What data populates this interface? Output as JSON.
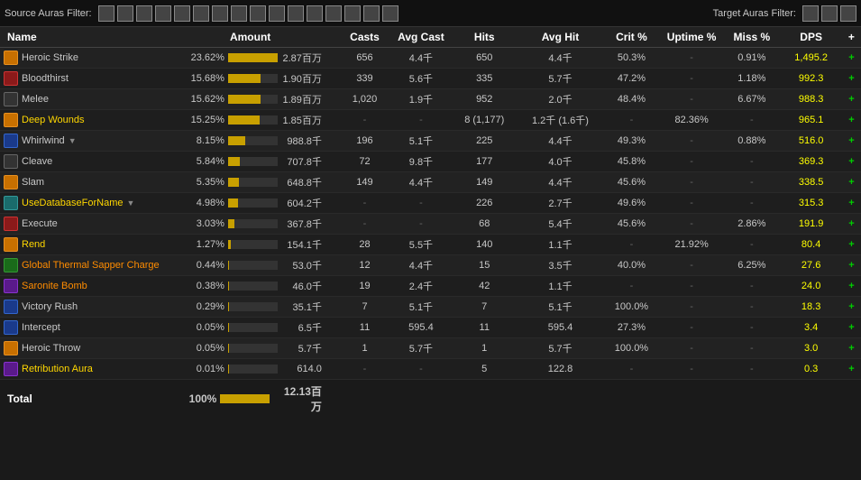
{
  "topBar": {
    "sourceLabel": "Source Auras Filter:",
    "targetLabel": "Target Auras Filter:"
  },
  "table": {
    "headers": [
      "Name",
      "Amount",
      "",
      "Casts",
      "Avg Cast",
      "Hits",
      "Avg Hit",
      "Crit %",
      "Uptime %",
      "Miss %",
      "DPS",
      "+"
    ],
    "rows": [
      {
        "icon": "orange",
        "name": "Heroic Strike",
        "nameStyle": "",
        "pct": "23.62%",
        "barW": 100,
        "amount": "2.87百万",
        "casts": "656",
        "avgCast": "4.4千",
        "hits": "650",
        "avgHit": "4.4千",
        "crit": "50.3%",
        "uptime": "-",
        "miss": "0.91%",
        "dps": "1,495.2"
      },
      {
        "icon": "red",
        "name": "Bloodthirst",
        "nameStyle": "",
        "pct": "15.68%",
        "barW": 66,
        "amount": "1.90百万",
        "casts": "339",
        "avgCast": "5.6千",
        "hits": "335",
        "avgHit": "5.7千",
        "crit": "47.2%",
        "uptime": "-",
        "miss": "1.18%",
        "dps": "992.3"
      },
      {
        "icon": "dark",
        "name": "Melee",
        "nameStyle": "",
        "pct": "15.62%",
        "barW": 66,
        "amount": "1.89百万",
        "casts": "1,020",
        "avgCast": "1.9千",
        "hits": "952",
        "avgHit": "2.0千",
        "crit": "48.4%",
        "uptime": "-",
        "miss": "6.67%",
        "dps": "988.3"
      },
      {
        "icon": "orange",
        "name": "Deep Wounds",
        "nameStyle": "yellow",
        "pct": "15.25%",
        "barW": 64,
        "amount": "1.85百万",
        "casts": "-",
        "avgCast": "-",
        "hits": "8 (1,177)",
        "avgHit": "1.2千 (1.6千)",
        "crit": "-",
        "uptime": "82.36%",
        "miss": "-",
        "dps": "965.1"
      },
      {
        "icon": "blue",
        "name": "Whirlwind",
        "nameStyle": "",
        "pct": "8.15%",
        "barW": 34,
        "amount": "988.8千",
        "casts": "196",
        "avgCast": "5.1千",
        "hits": "225",
        "avgHit": "4.4千",
        "crit": "49.3%",
        "uptime": "-",
        "miss": "0.88%",
        "dps": "516.0",
        "hasArrow": true
      },
      {
        "icon": "dark",
        "name": "Cleave",
        "nameStyle": "",
        "pct": "5.84%",
        "barW": 24,
        "amount": "707.8千",
        "casts": "72",
        "avgCast": "9.8千",
        "hits": "177",
        "avgHit": "4.0千",
        "crit": "45.8%",
        "uptime": "-",
        "miss": "-",
        "dps": "369.3"
      },
      {
        "icon": "orange",
        "name": "Slam",
        "nameStyle": "",
        "pct": "5.35%",
        "barW": 22,
        "amount": "648.8千",
        "casts": "149",
        "avgCast": "4.4千",
        "hits": "149",
        "avgHit": "4.4千",
        "crit": "45.6%",
        "uptime": "-",
        "miss": "-",
        "dps": "338.5"
      },
      {
        "icon": "teal",
        "name": "UseDatabaseForName",
        "nameStyle": "yellow",
        "pct": "4.98%",
        "barW": 20,
        "amount": "604.2千",
        "casts": "-",
        "avgCast": "-",
        "hits": "226",
        "avgHit": "2.7千",
        "crit": "49.6%",
        "uptime": "-",
        "miss": "-",
        "dps": "315.3",
        "hasArrow": true
      },
      {
        "icon": "red",
        "name": "Execute",
        "nameStyle": "",
        "pct": "3.03%",
        "barW": 12,
        "amount": "367.8千",
        "casts": "-",
        "avgCast": "-",
        "hits": "68",
        "avgHit": "5.4千",
        "crit": "45.6%",
        "uptime": "-",
        "miss": "2.86%",
        "dps": "191.9"
      },
      {
        "icon": "orange",
        "name": "Rend",
        "nameStyle": "yellow",
        "pct": "1.27%",
        "barW": 5,
        "amount": "154.1千",
        "casts": "28",
        "avgCast": "5.5千",
        "hits": "140",
        "avgHit": "1.1千",
        "crit": "-",
        "uptime": "21.92%",
        "miss": "-",
        "dps": "80.4"
      },
      {
        "icon": "green",
        "name": "Global Thermal Sapper Charge",
        "nameStyle": "orange",
        "pct": "0.44%",
        "barW": 2,
        "amount": "53.0千",
        "casts": "12",
        "avgCast": "4.4千",
        "hits": "15",
        "avgHit": "3.5千",
        "crit": "40.0%",
        "uptime": "-",
        "miss": "6.25%",
        "dps": "27.6"
      },
      {
        "icon": "purple",
        "name": "Saronite Bomb",
        "nameStyle": "orange",
        "pct": "0.38%",
        "barW": 2,
        "amount": "46.0千",
        "casts": "19",
        "avgCast": "2.4千",
        "hits": "42",
        "avgHit": "1.1千",
        "crit": "-",
        "uptime": "-",
        "miss": "-",
        "dps": "24.0"
      },
      {
        "icon": "blue",
        "name": "Victory Rush",
        "nameStyle": "",
        "pct": "0.29%",
        "barW": 1,
        "amount": "35.1千",
        "casts": "7",
        "avgCast": "5.1千",
        "hits": "7",
        "avgHit": "5.1千",
        "crit": "100.0%",
        "uptime": "-",
        "miss": "-",
        "dps": "18.3"
      },
      {
        "icon": "blue",
        "name": "Intercept",
        "nameStyle": "",
        "pct": "0.05%",
        "barW": 1,
        "amount": "6.5千",
        "casts": "11",
        "avgCast": "595.4",
        "hits": "11",
        "avgHit": "595.4",
        "crit": "27.3%",
        "uptime": "-",
        "miss": "-",
        "dps": "3.4"
      },
      {
        "icon": "orange",
        "name": "Heroic Throw",
        "nameStyle": "",
        "pct": "0.05%",
        "barW": 1,
        "amount": "5.7千",
        "casts": "1",
        "avgCast": "5.7千",
        "hits": "1",
        "avgHit": "5.7千",
        "crit": "100.0%",
        "uptime": "-",
        "miss": "-",
        "dps": "3.0"
      },
      {
        "icon": "purple",
        "name": "Retribution Aura",
        "nameStyle": "yellow",
        "pct": "0.01%",
        "barW": 1,
        "amount": "614.0",
        "casts": "-",
        "avgCast": "-",
        "hits": "5",
        "avgHit": "122.8",
        "crit": "-",
        "uptime": "-",
        "miss": "-",
        "dps": "0.3"
      }
    ],
    "footer": {
      "label": "Total",
      "pct": "100%",
      "amount": "12.13百万"
    }
  }
}
